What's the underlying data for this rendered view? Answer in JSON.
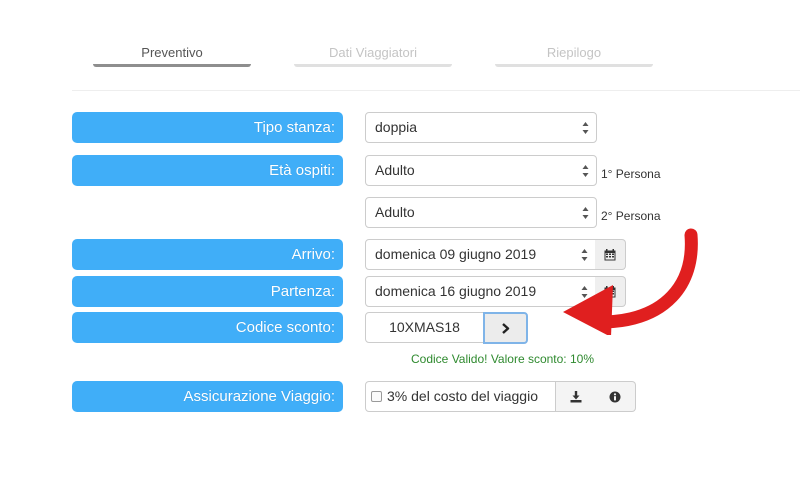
{
  "steps": [
    {
      "label": "Preventivo",
      "state": "active"
    },
    {
      "label": "Dati Viaggiatori",
      "state": "inactive"
    },
    {
      "label": "Riepilogo",
      "state": "inactive"
    }
  ],
  "form": {
    "room_type": {
      "label": "Tipo stanza:",
      "value": "doppia"
    },
    "guest_ages": {
      "label": "Età ospiti:",
      "persons": [
        {
          "value": "Adulto",
          "note": "1° Persona"
        },
        {
          "value": "Adulto",
          "note": "2° Persona"
        }
      ]
    },
    "arrival": {
      "label": "Arrivo:",
      "value": "domenica 09 giugno 2019"
    },
    "departure": {
      "label": "Partenza:",
      "value": "domenica 16 giugno 2019"
    },
    "discount_code": {
      "label": "Codice sconto:",
      "value": "10XMAS18",
      "message": "Codice Valido! Valore sconto: 10%"
    },
    "insurance": {
      "label": "Assicurazione Viaggio:",
      "option_text": "3% del costo del viaggio",
      "checked": false
    }
  },
  "colors": {
    "label_bg": "#40aef8",
    "valid_text": "#2f8a2f",
    "annotation_arrow": "#e01f1f"
  },
  "icons": {
    "calendar": "calendar-icon",
    "go": "chevron-right-icon",
    "download": "download-icon",
    "info": "info-circle-icon",
    "select_arrows": "updown-arrows-icon"
  }
}
